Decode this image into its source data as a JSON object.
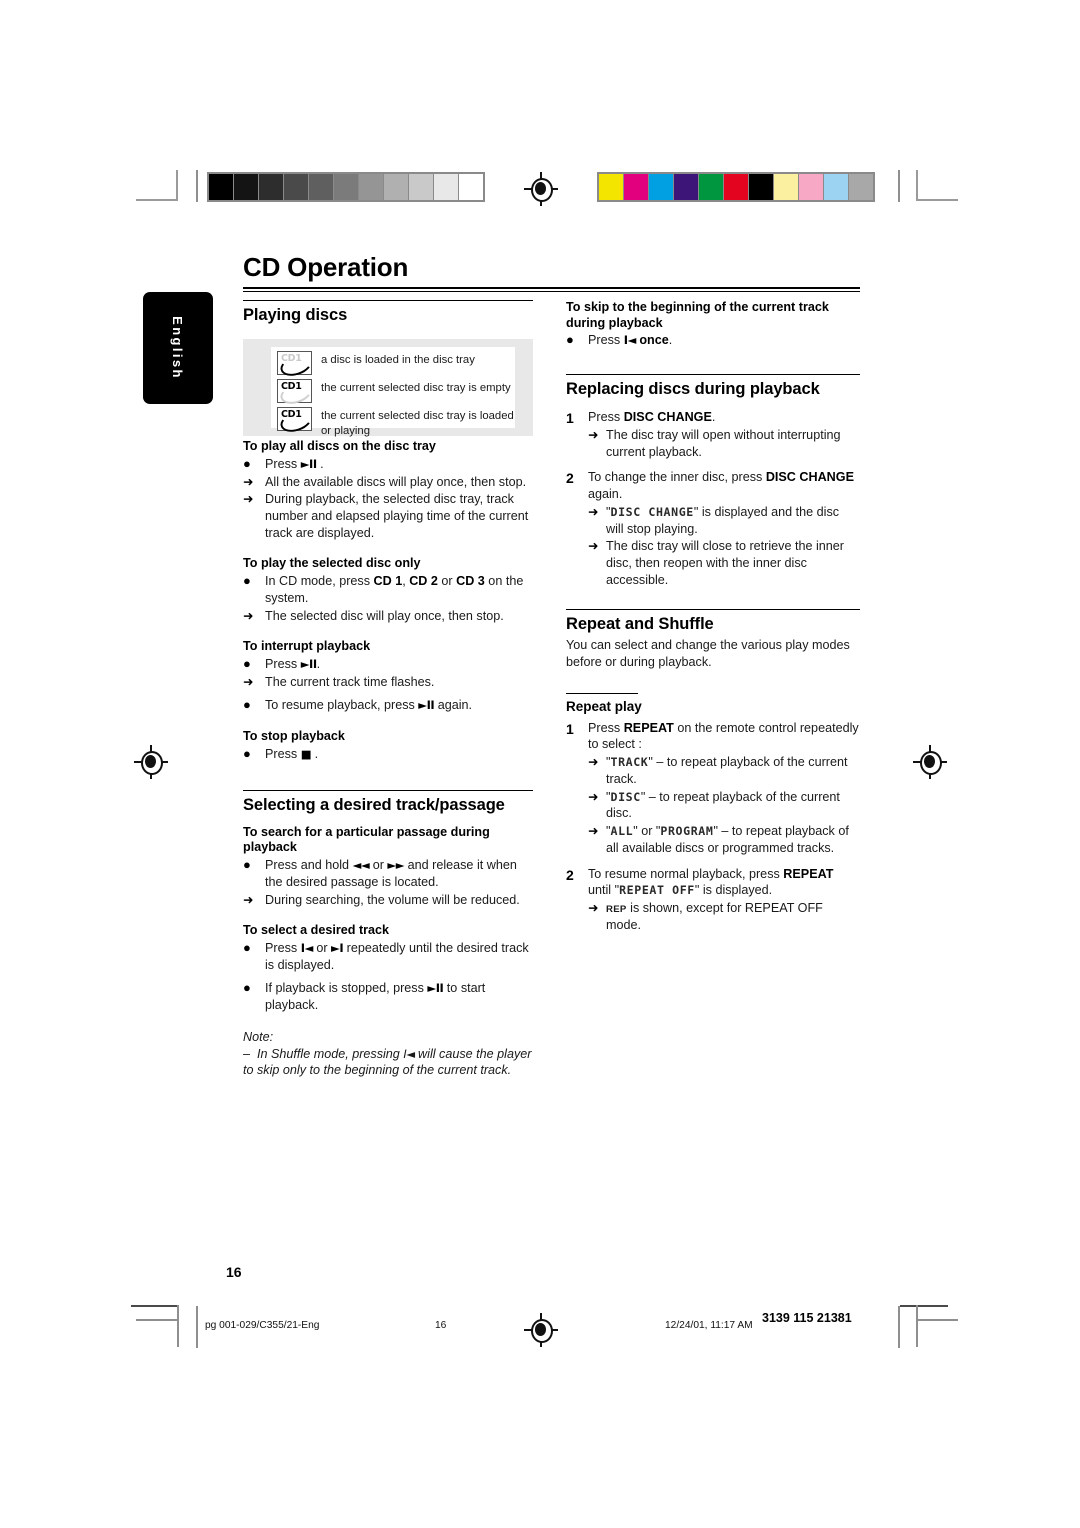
{
  "document": {
    "chapter_title": "CD Operation",
    "language_tab": "English",
    "page_number": "16"
  },
  "legend": {
    "rows": [
      {
        "icon": "disc-loaded-icon",
        "label": "CD1",
        "text": "a disc is loaded in the disc tray"
      },
      {
        "icon": "disc-empty-icon",
        "label": "CD1",
        "text": "the current selected disc tray is empty"
      },
      {
        "icon": "disc-playing-icon",
        "label": "CD1",
        "text": "the current selected disc tray is loaded or playing"
      }
    ]
  },
  "left_column": {
    "section_playing_discs": {
      "heading": "Playing discs",
      "blocks": [
        {
          "sub": "To play all discs on the disc tray",
          "lines": [
            {
              "marker": "bullet",
              "text": "Press ►II ."
            },
            {
              "marker": "arrow",
              "text": "All the available discs will play once, then stop."
            },
            {
              "marker": "arrow",
              "text": "During playback, the selected disc tray, track number and elapsed playing time of the current track are displayed."
            }
          ]
        },
        {
          "sub": "To play the selected disc only",
          "lines": [
            {
              "marker": "bullet",
              "text": "In CD mode, press CD 1, CD 2 or CD 3 on the system."
            },
            {
              "marker": "arrow",
              "text": "The selected disc will play once, then stop."
            }
          ]
        },
        {
          "sub": "To interrupt playback",
          "lines": [
            {
              "marker": "bullet",
              "text": "Press ►II."
            },
            {
              "marker": "arrow",
              "text": "The current track time flashes."
            },
            {
              "marker": "bullet",
              "text": "To resume playback, press ►II again."
            }
          ]
        },
        {
          "sub": "To stop playback",
          "lines": [
            {
              "marker": "bullet",
              "text": "Press ■ ."
            }
          ]
        }
      ]
    },
    "section_selecting_track": {
      "heading": "Selecting a desired track/passage",
      "blocks": [
        {
          "sub": "To search for a particular passage during playback",
          "lines": [
            {
              "marker": "bullet",
              "text": "Press and hold ◄◄ or ►► and release it when the desired passage is located."
            },
            {
              "marker": "arrow",
              "text": "During searching, the volume will be reduced."
            }
          ]
        },
        {
          "sub": "To select a desired track",
          "lines": [
            {
              "marker": "bullet",
              "text": "Press I◄ or ►I repeatedly until the desired track is displayed."
            },
            {
              "marker": "bullet",
              "text": "If playback is stopped, press ►II to start playback."
            }
          ]
        }
      ],
      "note_label": "Note:",
      "note_text": "– In Shuffle mode, pressing I◄ will cause the player to skip only to the beginning of the current track."
    }
  },
  "right_column": {
    "skip_block": {
      "sub": "To skip to the beginning of the current track during playback",
      "line": "Press I◄ once."
    },
    "section_replacing_discs": {
      "heading": "Replacing discs during playback",
      "steps": [
        {
          "num": "1",
          "text": "Press DISC CHANGE.",
          "arrows": [
            "The disc tray will open without interrupting current playback."
          ]
        },
        {
          "num": "2",
          "text": "To change the inner disc, press DISC CHANGE again.",
          "arrows": [
            "\"DISC CHANGE\" is displayed and the disc will stop playing.",
            "The disc tray will close to retrieve the inner disc, then reopen with the inner disc accessible."
          ],
          "lcd_terms": [
            "DISC CHANGE"
          ]
        }
      ]
    },
    "section_repeat_shuffle": {
      "heading": "Repeat and Shuffle",
      "intro": "You can select and change the various play modes before or during playback.",
      "sub_heading": "Repeat play",
      "steps": [
        {
          "num": "1",
          "text": "Press REPEAT on the remote control repeatedly to select :",
          "arrows": [
            "\"TRACK\" – to repeat playback of the current track.",
            "\"DISC\" – to repeat playback of the current disc.",
            "\"ALL\" or \"PROGRAM\" – to repeat playback of all available discs or programmed tracks."
          ],
          "lcd_terms": [
            "TRACK",
            "DISC",
            "ALL",
            "PROGRAM"
          ]
        },
        {
          "num": "2",
          "text": "To resume normal playback, press REPEAT until \"REPEAT OFF\" is displayed.",
          "arrows": [
            "REP is shown, except for REPEAT OFF mode."
          ],
          "lcd_terms": [
            "REPEAT OFF"
          ]
        }
      ]
    }
  },
  "footer": {
    "file_name": "pg 001-029/C355/21-Eng",
    "page": "16",
    "timestamp": "12/24/01, 11:17 AM",
    "doc_code": "3139 115 21381"
  },
  "color_bars": {
    "grayscale": [
      "#000000",
      "#141414",
      "#2d2d2d",
      "#4a4a4a",
      "#5f5f5f",
      "#7b7b7b",
      "#959595",
      "#b0b0b0",
      "#c9c9c9",
      "#e8e8e8",
      "#ffffff"
    ],
    "color": [
      "#f3e500",
      "#e2007f",
      "#00a0e2",
      "#3d1478",
      "#009640",
      "#e30520",
      "#000000",
      "#faf0a0",
      "#f6a8c4",
      "#9cd2f2",
      "#a8a8a8"
    ]
  }
}
